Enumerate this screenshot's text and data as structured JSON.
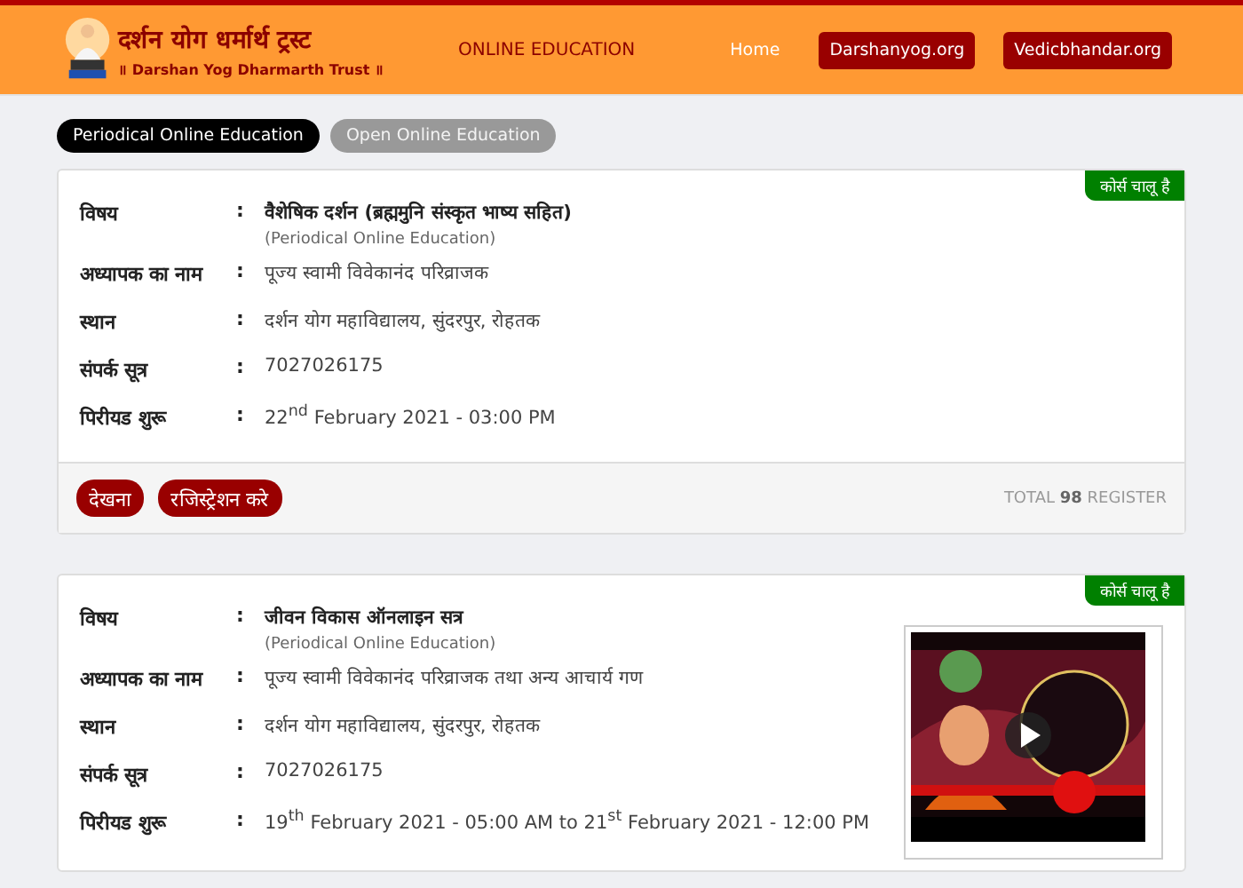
{
  "header": {
    "logo": {
      "title": "दर्शन योग धर्मार्थ ट्रस्ट",
      "subtitle": "॥ Darshan Yog Dharmarth Trust ॥"
    },
    "section": "ONLINE EDUCATION",
    "nav": [
      {
        "label": "Home",
        "kind": "link"
      },
      {
        "label": "Darshanyog.org",
        "kind": "button"
      },
      {
        "label": "Vedicbhandar.org",
        "kind": "button"
      }
    ]
  },
  "tabs": [
    {
      "label": "Periodical Online Education",
      "selected": true
    },
    {
      "label": "Open Online Education",
      "selected": false
    }
  ],
  "courses": [
    {
      "status": "कोर्स चालू है",
      "fields": [
        {
          "label": "विषय",
          "separator": ":",
          "value": "वैशेषिक दर्शन (ब्रह्ममुनि संस्कृत भाष्य सहित)",
          "note": "(Periodical Online Education)"
        },
        {
          "label": "अध्यापक का नाम",
          "separator": ":",
          "value": "पूज्य स्वामी विवेकानंद परिव्राजक"
        },
        {
          "label": "स्थान",
          "separator": ":",
          "value": "दर्शन योग महाविद्यालय, सुंदरपुर, रोहतक"
        },
        {
          "label": "संपर्क सूत्र",
          "separator": ":",
          "value": "7027026175"
        },
        {
          "label": "पिरीयड शुरू",
          "separator": ":",
          "value": "22$^{nd}$ February 2021 - 03:00 PM"
        }
      ],
      "buttons": [
        "देखना",
        "रजिस्ट्रेशन करे"
      ],
      "total": {
        "prefix": "TOTAL",
        "count": "98",
        "suffix": "REGISTER"
      }
    },
    {
      "status": "कोर्स चालू है",
      "fields": [
        {
          "label": "विषय",
          "separator": ":",
          "value": "जीवन विकास ऑनलाइन सत्र",
          "note": "(Periodical Online Education)"
        },
        {
          "label": "अध्यापक का नाम",
          "separator": ":",
          "value": "पूज्य स्वामी विवेकानंद परिव्राजक तथा अन्य आचार्य गण"
        },
        {
          "label": "स्थान",
          "separator": ":",
          "value": "दर्शन योग महाविद्यालय, सुंदरपुर, रोहतक"
        },
        {
          "label": "संपर्क सूत्र",
          "separator": ":",
          "value": "7027026175"
        },
        {
          "label": "पिरीयड शुरू",
          "separator": ":",
          "value": "19$^{th}$ February 2021 - 05:00 AM to 21$^{st}$ February 2021 - 12:00 PM"
        }
      ]
    }
  ]
}
